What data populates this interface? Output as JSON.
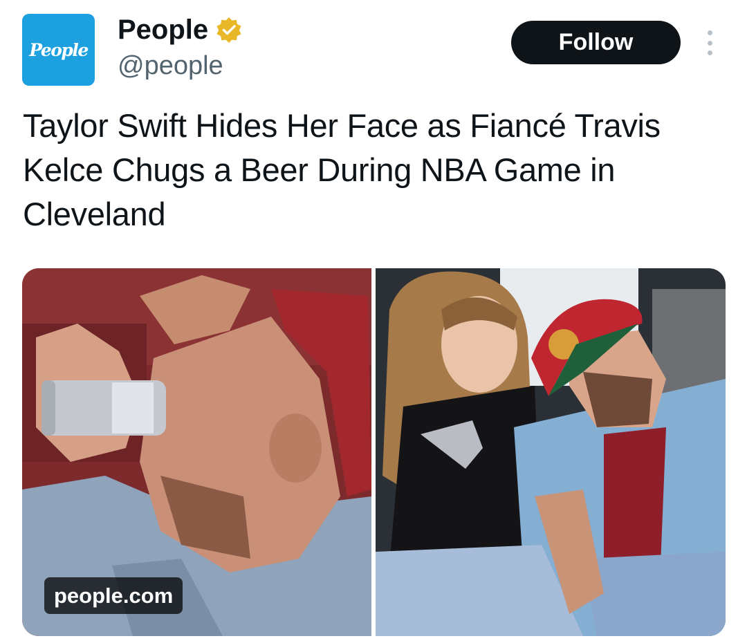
{
  "author": {
    "avatar_text": "People",
    "display_name": "People",
    "handle": "@people",
    "verified": true,
    "verified_badge_icon": "verified-badge-icon",
    "avatar_color": "#1da0e0"
  },
  "actions": {
    "follow_label": "Follow",
    "more_icon": "more-options-icon"
  },
  "tweet": {
    "text": "Taylor Swift Hides Her Face as Fiancé Travis Kelce Chugs a Beer During NBA Game in Cleveland"
  },
  "media": {
    "link_domain": "people.com",
    "images": [
      "left-photo",
      "right-photo"
    ]
  },
  "colors": {
    "follow_button": "#0f1419",
    "handle_text": "#536471",
    "verified_gold": "#e8b829"
  }
}
